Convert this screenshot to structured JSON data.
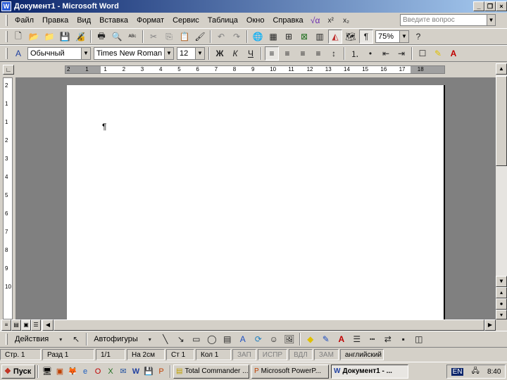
{
  "window": {
    "title": "Документ1 - Microsoft Word",
    "app_icon": "W"
  },
  "menu": [
    "Файл",
    "Правка",
    "Вид",
    "Вставка",
    "Формат",
    "Сервис",
    "Таблица",
    "Окно",
    "Справка"
  ],
  "ask_box": {
    "placeholder": "Введите вопрос"
  },
  "standard_toolbar": {
    "zoom": "75%"
  },
  "formatting_toolbar": {
    "style": "Обычный",
    "font": "Times New Roman",
    "size": "12"
  },
  "ruler": {
    "h_ticks": [
      "2",
      "1",
      "1",
      "2",
      "3",
      "4",
      "5",
      "6",
      "7",
      "8",
      "9",
      "10",
      "11",
      "12",
      "13",
      "14",
      "15",
      "16",
      "17",
      "18"
    ],
    "v_ticks": [
      "2",
      "1",
      "1",
      "2",
      "3",
      "4",
      "5",
      "6",
      "7",
      "8",
      "9",
      "10"
    ]
  },
  "document": {
    "cursor_glyph": "¶"
  },
  "drawing_toolbar": {
    "actions_label": "Действия",
    "autoshapes_label": "Автофигуры"
  },
  "status": {
    "page": "Стр. 1",
    "section": "Разд 1",
    "pages": "1/1",
    "at": "На 2см",
    "line": "Ст 1",
    "col": "Кол 1",
    "rec": "ЗАП",
    "trk": "ИСПР",
    "ext": "ВДЛ",
    "ovr": "ЗАМ",
    "lang": "английский"
  },
  "taskbar": {
    "start_label": "Пуск",
    "tasks": [
      "Total Commander ...",
      "Microsoft PowerP...",
      "Документ1 - ..."
    ],
    "lang": "EN",
    "clock": "8:40"
  }
}
